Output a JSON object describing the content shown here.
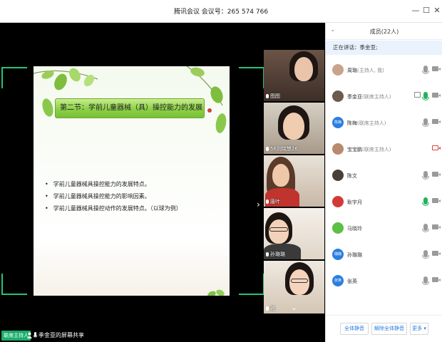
{
  "window": {
    "title": "腾讯会议  会议号：265 574 766",
    "minimize_label": "—",
    "maximize_label": "☐",
    "close_label": "✕"
  },
  "slide": {
    "title": "第二节：学前儿童器械（具）操控能力的发展",
    "bullets": [
      "学前儿童器械具操控能力的发展特点。",
      "学前儿童器械具操控能力的影响因素。",
      "学前儿童器械具操控动作的发展特点。（以球为例）"
    ]
  },
  "video_tiles": [
    {
      "name": "图图"
    },
    {
      "name": "56刘晓慧26"
    },
    {
      "name": "唐叶"
    },
    {
      "name": "孙璐璐"
    },
    {
      "name": "雅"
    }
  ],
  "bottom_bar": {
    "host_badge": "联席主持人",
    "share_label": "季金亚的屏幕共享"
  },
  "sidebar": {
    "title": "成员(22人)",
    "speaking": "正在讲话：季金亚;",
    "members": [
      {
        "name": "周璐",
        "role": "(主持人, 我)",
        "avatar_color": "#c9a38b",
        "mic": "gray",
        "cam": "gray"
      },
      {
        "name": "季金亚",
        "role": "(联席主持人)",
        "avatar_color": "#6b5a4e",
        "mic": "green",
        "cam": "gray",
        "sharing": true
      },
      {
        "name": "陈梅",
        "role": "(联席主持人)",
        "avatar_color": "#2b7de1",
        "avatar_text": "陈梅",
        "mic": "gray",
        "cam": "gray"
      },
      {
        "name": "宝宝鹏",
        "role": "(联席主持人)",
        "avatar_color": "#b88a70",
        "mic": "none",
        "cam": "red"
      },
      {
        "name": "陈文",
        "role": "",
        "avatar_color": "#4a3f36",
        "mic": "gray",
        "cam": "gray"
      },
      {
        "name": "耿宇月",
        "role": "",
        "avatar_color": "#d23a3a",
        "mic": "green",
        "cam": "gray"
      },
      {
        "name": "马晓玲",
        "role": "",
        "avatar_color": "#5cbf46",
        "mic": "gray",
        "cam": "gray"
      },
      {
        "name": "孙璐璐",
        "role": "",
        "avatar_color": "#2b7de1",
        "avatar_text": "璐璐",
        "mic": "gray",
        "cam": "gray"
      },
      {
        "name": "张英",
        "role": "",
        "avatar_color": "#2b7de1",
        "avatar_text": "张英",
        "mic": "gray",
        "cam": "gray"
      }
    ],
    "footer": {
      "mute_all": "全体静音",
      "unmute_all": "解除全体静音",
      "more": "更多 ▾"
    }
  },
  "colors": {
    "accent_green": "#1aad6b",
    "accent_blue": "#2b7de1",
    "mic_green": "#22b35e",
    "cam_red": "#e0413b"
  }
}
